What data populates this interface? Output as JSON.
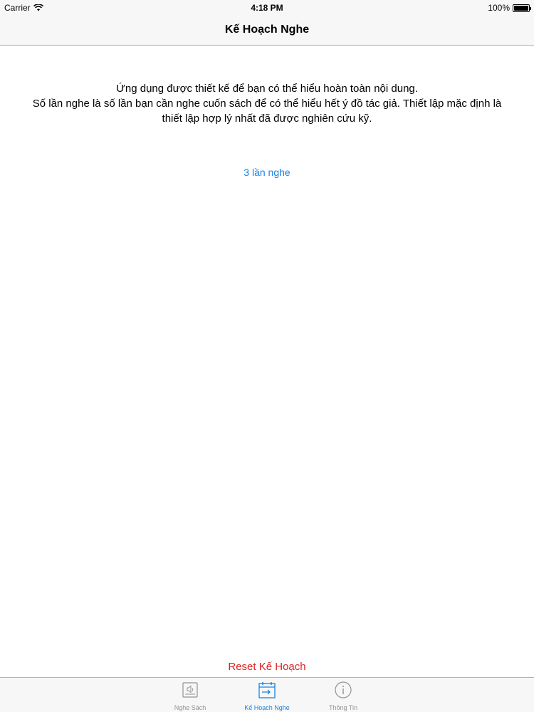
{
  "status_bar": {
    "carrier": "Carrier",
    "time": "4:18 PM",
    "battery": "100%"
  },
  "nav": {
    "title": "Kế Hoạch Nghe"
  },
  "content": {
    "description_lines": [
      "Ứng dụng được thiết kế để bạn có thể hiểu hoàn toàn nội dung.",
      "Số lần nghe là số lần bạn cần nghe cuốn sách để có thể hiểu hết ý đồ tác giả. Thiết lập mặc định là",
      "thiết lập hợp lý nhất đã được nghiên cứu kỹ."
    ],
    "listen_count": "3 lần nghe",
    "reset_label": "Reset Kế Hoạch"
  },
  "tabs": [
    {
      "label": "Nghe Sách",
      "icon": "book-speaker-icon",
      "active": false
    },
    {
      "label": "Kế Hoạch Nghe",
      "icon": "calendar-icon",
      "active": true
    },
    {
      "label": "Thông Tin",
      "icon": "info-icon",
      "active": false
    }
  ],
  "colors": {
    "accent": "#1a82e2",
    "destructive": "#e02020",
    "inactive_tab": "#929292"
  }
}
